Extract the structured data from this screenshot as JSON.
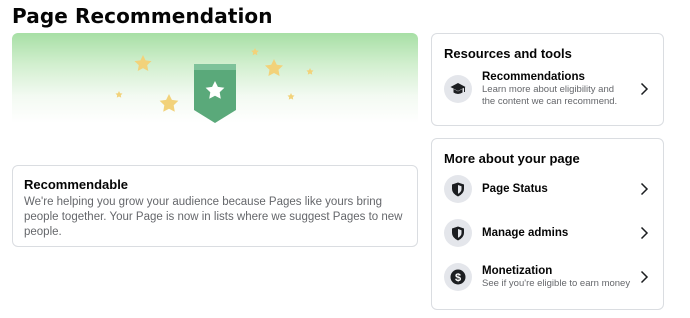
{
  "page_title": "Page Recommendation",
  "recommendable": {
    "title": "Recommendable",
    "description": "We're helping you grow your audience because Pages like yours bring people together. Your Page is now in lists where we suggest Pages to new people."
  },
  "resources": {
    "title": "Resources and tools",
    "items": [
      {
        "label": "Recommendations",
        "description_line1": "Learn more about eligibility and",
        "description_line2": "the content we can recommend.",
        "icon": "graduation-cap-icon"
      }
    ]
  },
  "more": {
    "title": "More about your page",
    "items": [
      {
        "label": "Page Status",
        "icon": "shield-icon"
      },
      {
        "label": "Manage admins",
        "icon": "shield-icon"
      },
      {
        "label": "Monetization",
        "description": "See if you're eligible to earn money",
        "icon": "dollar-icon"
      }
    ]
  },
  "colors": {
    "hero_green": "#a7dfa5",
    "badge_green": "#5aa97a",
    "star_gold": "#f2d27a",
    "text_primary": "#050505",
    "text_secondary": "#65676b",
    "border": "#dadde1",
    "icon_bg": "#e4e6eb"
  }
}
